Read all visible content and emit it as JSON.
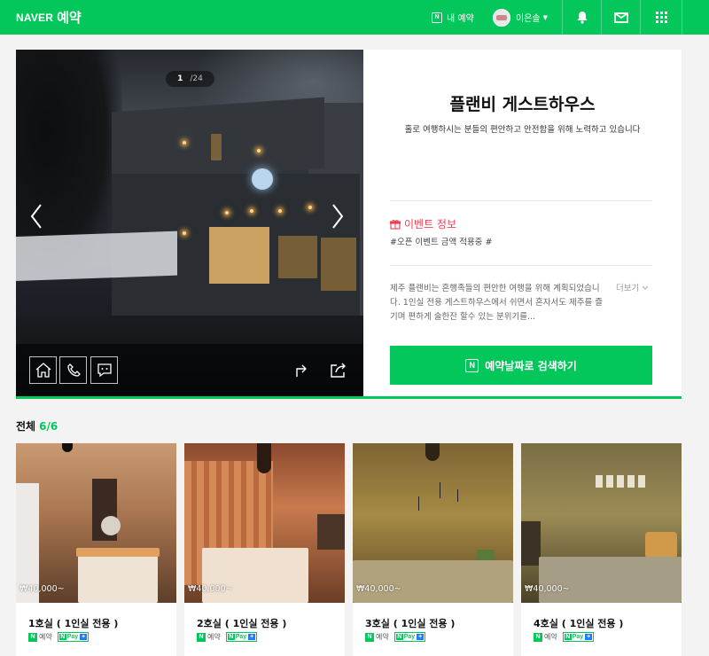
{
  "header": {
    "brand_naver": "NAVER",
    "brand_service": "예약",
    "my_booking_label": "내 예약",
    "user_name": "이은솔",
    "icons": [
      "notification-bell-icon",
      "mail-icon",
      "apps-grid-icon"
    ],
    "accent_color": "#03c75a"
  },
  "gallery": {
    "current": "1",
    "total": "/24",
    "toolbar_icons": [
      "home-icon",
      "phone-icon",
      "talk-icon",
      "directions-icon",
      "share-icon"
    ]
  },
  "shop": {
    "title": "플랜비 게스트하우스",
    "description": "홀로 여행하시는 분들의 편안하고 안전함을 위해 노력하고 있습니다",
    "event_heading": "이벤트 정보",
    "event_text": "#오픈 이벤트 금액 적용중 #",
    "intro": "제주 플랜비는 혼행족들의 편안한 여행을 위해 계획되었습니다. 1인실 전용 게스트하우스에서 쉬면서 혼자서도 제주를 즐기며 편하게 술한잔 할수 있는 분위기를...",
    "more_label": "더보기",
    "book_button": "예약날짜로 검색하기",
    "event_color": "#f33d4e"
  },
  "rooms_section": {
    "title": "전체",
    "count": "6/6"
  },
  "rooms": [
    {
      "name": "1호실 ( 1인실 전용 )",
      "price": "₩40,000~",
      "badge_booking": "예약",
      "badge_pay": "Pay"
    },
    {
      "name": "2호실 ( 1인실 전용 )",
      "price": "₩40,000~",
      "badge_booking": "예약",
      "badge_pay": "Pay"
    },
    {
      "name": "3호실 ( 1인실 전용 )",
      "price": "₩40,000~",
      "badge_booking": "예약",
      "badge_pay": "Pay"
    },
    {
      "name": "4호실 ( 1인실 전용 )",
      "price": "₩40,000~",
      "badge_booking": "예약",
      "badge_pay": "Pay"
    }
  ]
}
